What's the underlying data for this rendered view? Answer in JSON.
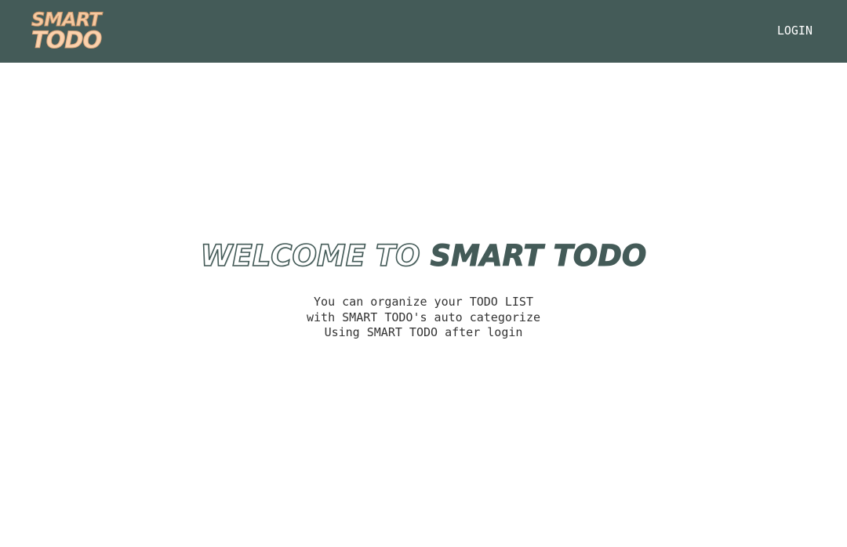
{
  "header": {
    "logo_line1": "SMART",
    "logo_line2": "TODO",
    "login_label": "LOGIN"
  },
  "hero": {
    "title_part1": "WELCOME TO ",
    "title_part2": "SMART TODO",
    "lines": [
      "You can organize your TODO LIST",
      "with SMART TODO's auto categorize",
      "Using SMART TODO after login"
    ]
  },
  "colors": {
    "header_bg": "#445b58",
    "logo": "#f6c9a0",
    "title_brand": "#445b58"
  }
}
